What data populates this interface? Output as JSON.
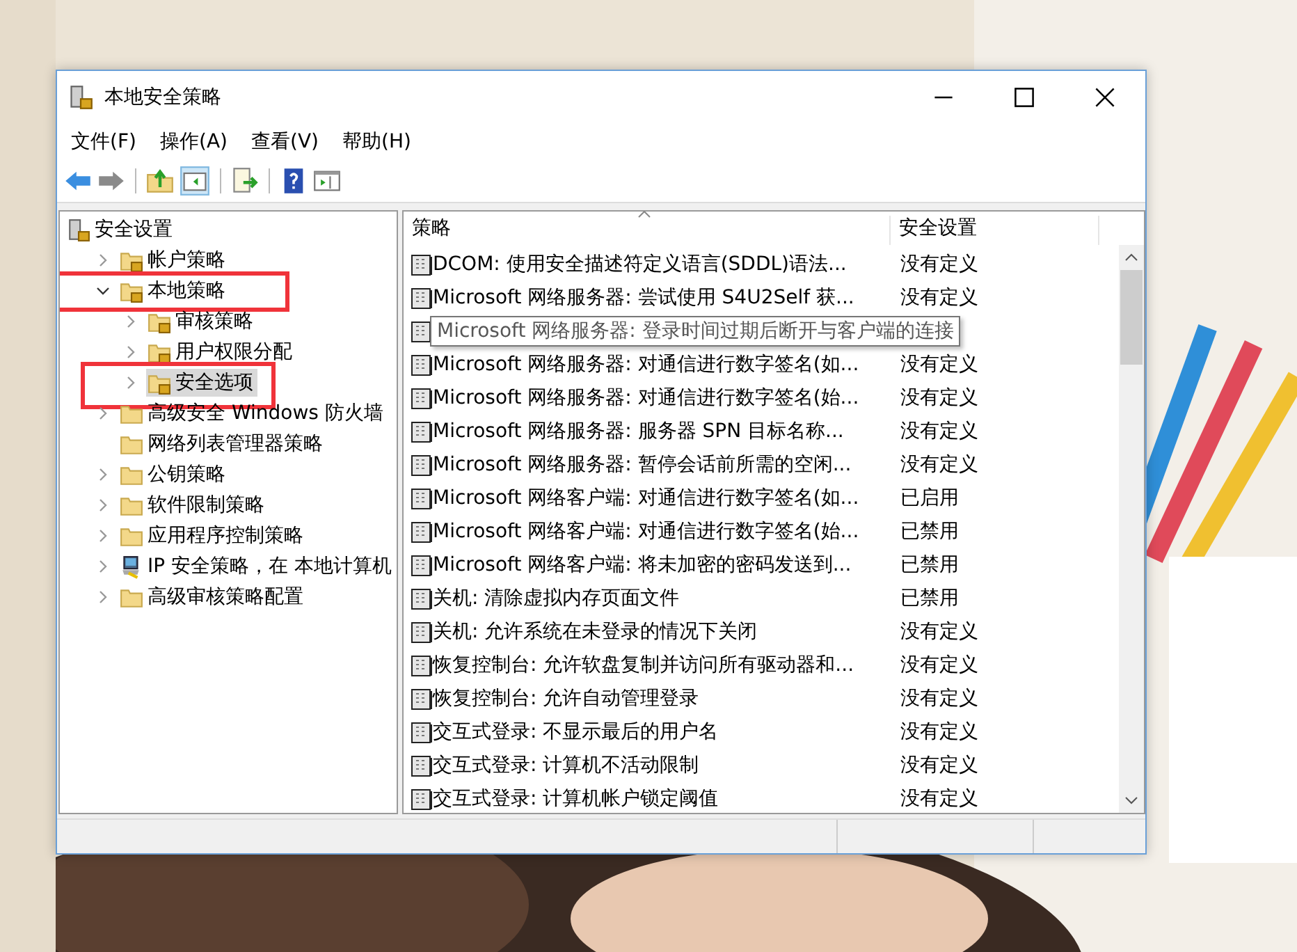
{
  "window": {
    "title": "本地安全策略"
  },
  "menu": [
    "文件(F)",
    "操作(A)",
    "查看(V)",
    "帮助(H)"
  ],
  "tree": [
    {
      "label": "安全设置",
      "kind": "root",
      "selected": false,
      "highlighted": false,
      "children": [
        {
          "label": "帐户策略",
          "kind": "locked",
          "expandable": true,
          "expanded": false,
          "selected": false,
          "highlighted": false
        },
        {
          "label": "本地策略",
          "kind": "locked",
          "expandable": true,
          "expanded": true,
          "selected": false,
          "highlighted": true,
          "children": [
            {
              "label": "审核策略",
              "kind": "locked",
              "expandable": true,
              "expanded": false,
              "selected": false,
              "highlighted": false
            },
            {
              "label": "用户权限分配",
              "kind": "locked",
              "expandable": true,
              "expanded": false,
              "selected": false,
              "highlighted": false
            },
            {
              "label": "安全选项",
              "kind": "locked",
              "expandable": true,
              "expanded": false,
              "selected": true,
              "highlighted": true
            }
          ]
        },
        {
          "label": "高级安全 Windows 防火墙",
          "kind": "folder",
          "expandable": true,
          "expanded": false,
          "selected": false,
          "highlighted": false
        },
        {
          "label": "网络列表管理器策略",
          "kind": "folder",
          "expandable": false,
          "selected": false,
          "highlighted": false
        },
        {
          "label": "公钥策略",
          "kind": "folder",
          "expandable": true,
          "expanded": false,
          "selected": false,
          "highlighted": false
        },
        {
          "label": "软件限制策略",
          "kind": "folder",
          "expandable": true,
          "expanded": false,
          "selected": false,
          "highlighted": false
        },
        {
          "label": "应用程序控制策略",
          "kind": "folder",
          "expandable": true,
          "expanded": false,
          "selected": false,
          "highlighted": false
        },
        {
          "label": "IP 安全策略，在 本地计算机",
          "kind": "computer",
          "expandable": true,
          "expanded": false,
          "selected": false,
          "highlighted": false
        },
        {
          "label": "高级审核策略配置",
          "kind": "folder",
          "expandable": true,
          "expanded": false,
          "selected": false,
          "highlighted": false
        }
      ]
    }
  ],
  "table": {
    "columns": [
      "策略",
      "安全设置"
    ],
    "rows": [
      {
        "policy": "DCOM: 使用安全描述符定义语言(SDDL)语法...",
        "setting": "没有定义"
      },
      {
        "policy": "Microsoft 网络服务器: 尝试使用 S4U2Self 获...",
        "setting": "没有定义"
      },
      {
        "tooltip": "Microsoft 网络服务器: 登录时间过期后断开与客户端的连接"
      },
      {
        "policy": "Microsoft 网络服务器: 对通信进行数字签名(如...",
        "setting": "没有定义"
      },
      {
        "policy": "Microsoft 网络服务器: 对通信进行数字签名(始...",
        "setting": "没有定义"
      },
      {
        "policy": "Microsoft 网络服务器: 服务器 SPN 目标名称...",
        "setting": "没有定义"
      },
      {
        "policy": "Microsoft 网络服务器: 暂停会话前所需的空闲...",
        "setting": "没有定义"
      },
      {
        "policy": "Microsoft 网络客户端: 对通信进行数字签名(如...",
        "setting": "已启用"
      },
      {
        "policy": "Microsoft 网络客户端: 对通信进行数字签名(始...",
        "setting": "已禁用"
      },
      {
        "policy": "Microsoft 网络客户端: 将未加密的密码发送到...",
        "setting": "已禁用"
      },
      {
        "policy": "关机: 清除虚拟内存页面文件",
        "setting": "已禁用"
      },
      {
        "policy": "关机: 允许系统在未登录的情况下关闭",
        "setting": "没有定义"
      },
      {
        "policy": "恢复控制台: 允许软盘复制并访问所有驱动器和...",
        "setting": "没有定义"
      },
      {
        "policy": "恢复控制台: 允许自动管理登录",
        "setting": "没有定义"
      },
      {
        "policy": "交互式登录: 不显示最后的用户名",
        "setting": "没有定义"
      },
      {
        "policy": "交互式登录: 计算机不活动限制",
        "setting": "没有定义"
      },
      {
        "policy": "交互式登录: 计算机帐户锁定阈值",
        "setting": "没有定义"
      }
    ]
  }
}
